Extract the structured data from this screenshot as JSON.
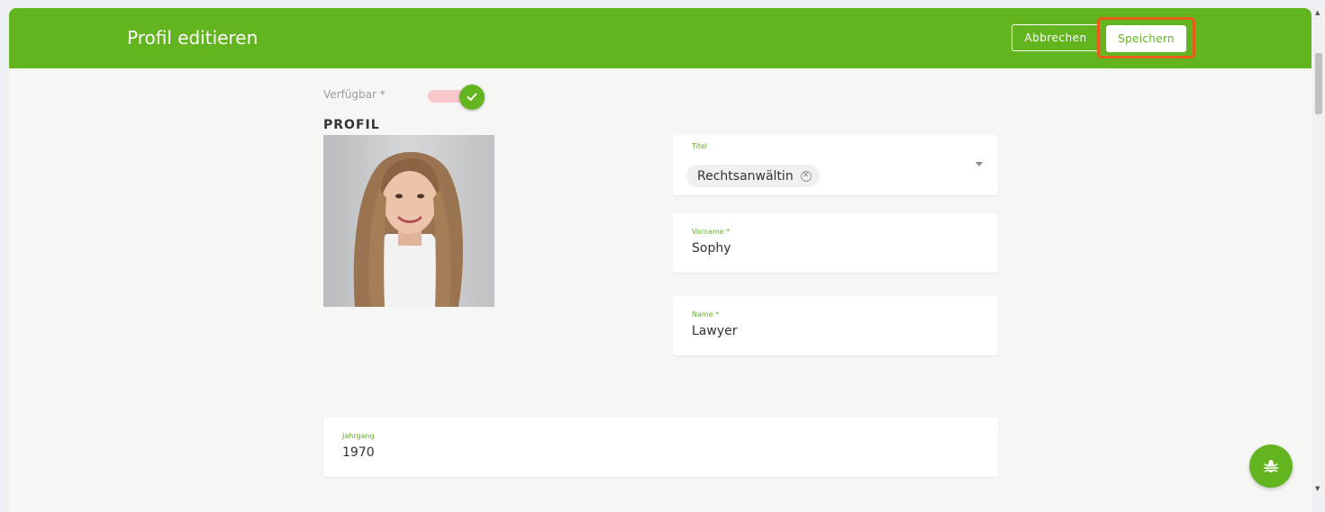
{
  "header": {
    "title": "Profil editieren",
    "cancel_label": "Abbrechen",
    "save_label": "Speichern"
  },
  "availability": {
    "label": "Verfügbar *",
    "enabled": true
  },
  "profile": {
    "section_title": "PROFIL"
  },
  "form": {
    "titel": {
      "label": "Titel",
      "value": "Rechtsanwältin"
    },
    "vorname": {
      "label": "Vorname *",
      "value": "Sophy"
    },
    "name": {
      "label": "Name *",
      "value": "Lawyer"
    },
    "jahrgang": {
      "label": "Jahrgang",
      "value": "1970"
    }
  },
  "icons": {
    "toggle": "check-icon",
    "chip_remove": "clear-circle-icon",
    "dropdown": "caret-down-icon",
    "bug": "bug-icon"
  },
  "colors": {
    "brand_green": "#63b51f",
    "highlight_orange": "#e85b1a",
    "toggle_track": "#f9c6cc"
  }
}
